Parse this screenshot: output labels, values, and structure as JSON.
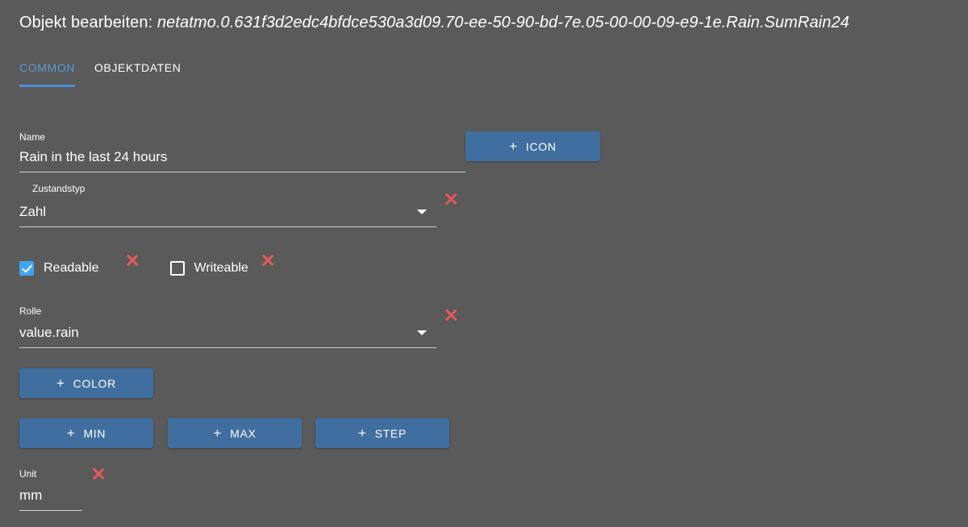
{
  "header": {
    "title_prefix": "Objekt bearbeiten: ",
    "object_id": "netatmo.0.631f3d2edc4bfdce530a3d09.70-ee-50-90-bd-7e.05-00-00-09-e9-1e.Rain.SumRain24"
  },
  "tabs": [
    {
      "label": "COMMON",
      "active": true
    },
    {
      "label": "OBJEKTDATEN",
      "active": false
    }
  ],
  "form": {
    "name": {
      "label": "Name",
      "value": "Rain in the last 24 hours"
    },
    "icon_button": {
      "label": "ICON",
      "plus": "+"
    },
    "type": {
      "label": "Zustandstyp",
      "value": "Zahl"
    },
    "readable": {
      "label": "Readable",
      "checked": true
    },
    "writeable": {
      "label": "Writeable",
      "checked": false
    },
    "role": {
      "label": "Rolle",
      "value": "value.rain"
    },
    "color_button": {
      "label": "COLOR",
      "plus": "+"
    },
    "min_button": {
      "label": "MIN",
      "plus": "+"
    },
    "max_button": {
      "label": "MAX",
      "plus": "+"
    },
    "step_button": {
      "label": "STEP",
      "plus": "+"
    },
    "unit": {
      "label": "Unit",
      "value": "mm"
    }
  },
  "colors": {
    "background": "#5a5a5a",
    "accent_blue": "#4a90d9",
    "tab_active": "#5b9bd5",
    "button_blue": "#406f9f",
    "delete_red": "#e8585a",
    "checkbox_blue": "#41a5f5",
    "underline": "#cfcfcf"
  },
  "icons": {
    "clear_type": "close-x-icon",
    "clear_readable": "close-x-icon",
    "clear_writeable": "close-x-icon",
    "clear_role": "close-x-icon",
    "clear_unit": "close-x-icon",
    "type_dropdown": "chevron-down-icon",
    "role_dropdown": "chevron-down-icon"
  }
}
